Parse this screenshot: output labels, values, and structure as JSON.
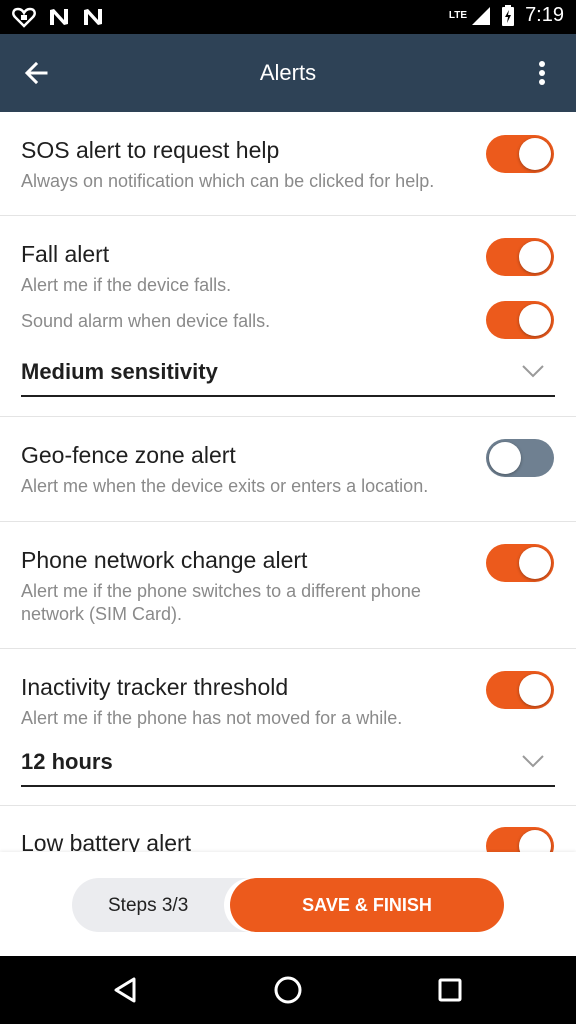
{
  "status_bar": {
    "time": "7:19",
    "network": "LTE",
    "left_icons": [
      "heart-icon",
      "n-icon",
      "n-icon"
    ],
    "right_icons": [
      "signal-icon",
      "battery-charging-icon"
    ]
  },
  "app_bar": {
    "title": "Alerts",
    "back_icon": "arrow-back-icon",
    "menu_icon": "more-vert-icon"
  },
  "alerts": {
    "sos": {
      "title": "SOS alert to request help",
      "description": "Always on notification which can be clicked for help.",
      "enabled": true
    },
    "fall": {
      "title": "Fall alert",
      "description": "Alert me if the device falls.",
      "enabled": true,
      "sound_label": "Sound alarm when device falls.",
      "sound_enabled": true,
      "sensitivity": "Medium sensitivity"
    },
    "geofence": {
      "title": "Geo-fence zone alert",
      "description": "Alert me when the device exits or enters a location.",
      "enabled": false
    },
    "network": {
      "title": "Phone network change alert",
      "description": "Alert me if the phone switches to a different phone network (SIM Card).",
      "enabled": true
    },
    "inactivity": {
      "title": "Inactivity tracker threshold",
      "description": "Alert me if the phone has not moved for a while.",
      "enabled": true,
      "threshold": "12 hours"
    },
    "battery": {
      "title": "Low battery alert",
      "enabled": true
    }
  },
  "footer": {
    "steps_label": "Steps 3/3",
    "save_label": "SAVE & FINISH"
  },
  "colors": {
    "accent": "#ec5a1c",
    "app_bar": "#2e4256",
    "toggle_off": "#6f8091"
  }
}
